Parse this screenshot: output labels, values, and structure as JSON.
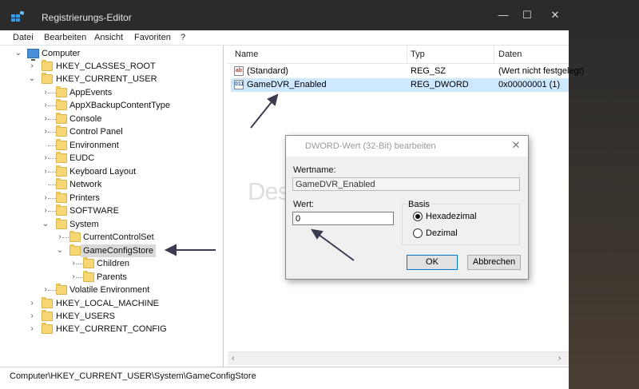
{
  "window": {
    "title": "Registrierungs-Editor"
  },
  "window_controls": {
    "minimize": "—",
    "maximize": "☐",
    "close": "✕"
  },
  "menu": [
    "Datei",
    "Bearbeiten",
    "Ansicht",
    "Favoriten",
    "?"
  ],
  "tree": {
    "root": "Computer",
    "items": [
      {
        "label": "HKEY_CLASSES_ROOT",
        "expander": "›"
      },
      {
        "label": "HKEY_CURRENT_USER",
        "expander": "⌄"
      },
      {
        "label": "AppEvents",
        "expander": "›"
      },
      {
        "label": "AppXBackupContentType",
        "expander": "›"
      },
      {
        "label": "Console",
        "expander": "›"
      },
      {
        "label": "Control Panel",
        "expander": "›"
      },
      {
        "label": "Environment",
        "expander": ""
      },
      {
        "label": "EUDC",
        "expander": "›"
      },
      {
        "label": "Keyboard Layout",
        "expander": "›"
      },
      {
        "label": "Network",
        "expander": ""
      },
      {
        "label": "Printers",
        "expander": "›"
      },
      {
        "label": "SOFTWARE",
        "expander": "›"
      },
      {
        "label": "System",
        "expander": "⌄"
      },
      {
        "label": "CurrentControlSet",
        "expander": "›"
      },
      {
        "label": "GameConfigStore",
        "expander": "⌄"
      },
      {
        "label": "Children",
        "expander": "›"
      },
      {
        "label": "Parents",
        "expander": "›"
      },
      {
        "label": "Volatile Environment",
        "expander": "›"
      },
      {
        "label": "HKEY_LOCAL_MACHINE",
        "expander": "›"
      },
      {
        "label": "HKEY_USERS",
        "expander": "›"
      },
      {
        "label": "HKEY_CURRENT_CONFIG",
        "expander": "›"
      }
    ]
  },
  "list": {
    "columns": [
      "Name",
      "Typ",
      "Daten"
    ],
    "rows": [
      {
        "icon": "ab",
        "name": "(Standard)",
        "type": "REG_SZ",
        "data": "(Wert nicht festgelegt)"
      },
      {
        "icon": "011",
        "name": "GameDVR_Enabled",
        "type": "REG_DWORD",
        "data": "0x00000001 (1)"
      }
    ]
  },
  "scrollbar": {
    "left": "‹",
    "right": "›"
  },
  "status": {
    "path": "Computer\\HKEY_CURRENT_USER\\System\\GameConfigStore"
  },
  "dialog": {
    "title": "DWORD-Wert (32-Bit) bearbeiten",
    "close": "✕",
    "name_label": "Wertname:",
    "name_value": "GameDVR_Enabled",
    "value_label": "Wert:",
    "value_value": "0",
    "base_label": "Basis",
    "radios": [
      {
        "label": "Hexadezimal",
        "checked": true
      },
      {
        "label": "Dezimal",
        "checked": false
      }
    ],
    "ok": "OK",
    "cancel": "Abbrechen"
  },
  "watermark": "Deskmodder.de",
  "colors": {
    "titlebar": "#2b2b2b",
    "selection": "#cde8ff",
    "tree_selection": "#d9d9d9",
    "folder": "#f7d774",
    "annotation_arrow": "#3c3c50"
  }
}
